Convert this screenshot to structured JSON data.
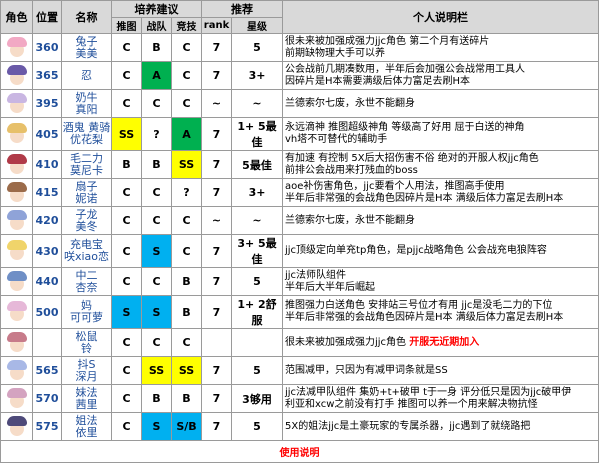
{
  "headers": {
    "avatar": "角色",
    "position": "位置",
    "name": "名称",
    "training_group": "培养建议",
    "recommend_group": "推荐",
    "push": "推图",
    "battle": "战队",
    "arena": "竞技",
    "rank": "rank",
    "star": "星级",
    "note": "个人说明栏"
  },
  "rows": [
    {
      "hair": "#f2a9c4",
      "position": "360",
      "name1": "兔子",
      "name2": "美美",
      "push": "C",
      "battle": "B",
      "arena": "C",
      "rank": "7",
      "star": "5",
      "note1": "很未来被加强成强力jjc角色 第二个月有送碎片",
      "note2": "前期缺物理大手可以养"
    },
    {
      "hair": "#6a5aa8",
      "position": "365",
      "name1": "忍",
      "name2": "",
      "push": "C",
      "battle": "A",
      "arena": "C",
      "rank": "7",
      "star": "3+",
      "note1": "公会战前几期凑数用，半年后会加强公会战常用工具人",
      "note2": "因碎片是H本需要满级后体力富足去刷H本"
    },
    {
      "hair": "#c9b6e2",
      "position": "395",
      "name1": "奶牛",
      "name2": "真阳",
      "push": "C",
      "battle": "C",
      "arena": "C",
      "rank": "~",
      "star": "~",
      "note1": "兰德索尔七废，永世不能翻身",
      "note2": ""
    },
    {
      "hair": "#e7c06a",
      "position": "405",
      "name1": "酒鬼 黄骑",
      "name2": "优花梨",
      "push": "SS",
      "battle": "?",
      "arena": "A",
      "rank": "7",
      "star": "1+ 5最佳",
      "note1": "永远滴神 推图超级神角 等级高了好用 屈于白送的神角",
      "note2": "vh塔不可替代的辅助手"
    },
    {
      "hair": "#b03a48",
      "position": "410",
      "name1": "毛二力",
      "name2": "莫尼卡",
      "push": "B",
      "battle": "B",
      "arena": "SS",
      "rank": "7",
      "star": "5最佳",
      "note1": "有加速 有控制 5X后大招伤害不俗 绝对的开服人权jjc角色",
      "note2": "前排公会战用来打残血的boss"
    },
    {
      "hair": "#9b6b4a",
      "position": "415",
      "name1": "扇子",
      "name2": "妮诺",
      "push": "C",
      "battle": "C",
      "arena": "?",
      "rank": "7",
      "star": "3+",
      "note1": "aoe补伤害角色，jjc要看个人用法，推图高手使用",
      "note2": "半年后非常强的会战角色因碎片是H本 满级后体力富足去刷H本"
    },
    {
      "hair": "#8fa3d8",
      "position": "420",
      "name1": "子龙",
      "name2": "美冬",
      "push": "C",
      "battle": "C",
      "arena": "C",
      "rank": "~",
      "star": "~",
      "note1": "兰德索尔七废，永世不能翻身",
      "note2": ""
    },
    {
      "hair": "#f0d46a",
      "position": "430",
      "name1": "充电宝",
      "name2": "咲xiao恋",
      "push": "C",
      "battle": "S",
      "arena": "C",
      "rank": "7",
      "star": "3+ 5最佳",
      "note1": "jjc顶级定向单充tp角色，是pjjc战略角色 公会战充电狼阵容",
      "note2": ""
    },
    {
      "hair": "#6f8fc6",
      "position": "440",
      "name1": "中二",
      "name2": "杏奈",
      "push": "C",
      "battle": "C",
      "arena": "B",
      "rank": "7",
      "star": "5",
      "note1": "jjc法师队组件",
      "note2": "半年后大半年后崛起"
    },
    {
      "hair": "#e6b8d8",
      "position": "500",
      "name1": "妈",
      "name2": "可可萝",
      "push": "S",
      "battle": "S",
      "arena": "B",
      "rank": "7",
      "star": "1+ 2舒服",
      "note1": "推图强力白送角色 安排站三号位才有用 jjc是没毛二力的下位",
      "note2": "半年后非常强的会战角色因碎片是H本 满级后体力富足去刷H本"
    },
    {
      "hair": "#c77b8a",
      "position": "",
      "name1": "松鼠",
      "name2": "铃",
      "push": "C",
      "battle": "C",
      "arena": "C",
      "rank": "",
      "star": "",
      "note1": "很未来被加强成强力jjc角色",
      "note1b": "开服无近期加入",
      "note2": ""
    },
    {
      "hair": "#a8b8e6",
      "position": "565",
      "name1": "抖S",
      "name2": "深月",
      "push": "C",
      "battle": "SS",
      "arena": "SS",
      "rank": "7",
      "star": "5",
      "note1": "范围减甲，只因为有减甲词条就是SS",
      "note2": ""
    },
    {
      "hair": "#d4a3c0",
      "position": "570",
      "name1": "妹法",
      "name2": "茜里",
      "push": "C",
      "battle": "B",
      "arena": "B",
      "rank": "7",
      "star": "3够用",
      "note1": "jjc法减甲队组件 集奶+t+破甲 t于一身 评分低只是因为jjc破甲伊",
      "note2": "利亚和xcw之前没有打手 推图可以养一个用来解决物抗怪"
    },
    {
      "hair": "#4e4a7a",
      "position": "575",
      "name1": "姐法",
      "name2": "依里",
      "push": "C",
      "battle": "S",
      "arena": "S/B",
      "rank": "7",
      "star": "5",
      "note1": "5X的姐法jjc是土豪玩家的专属杀器，jjc遇到了就绕路把",
      "note2": ""
    }
  ],
  "colors": {
    "yellow": "#ffff00",
    "green": "#00b050",
    "blue": "#00b0f0",
    "red": "#ff0000",
    "header_gray": "#d9d9d9"
  },
  "footer": "使用说明"
}
